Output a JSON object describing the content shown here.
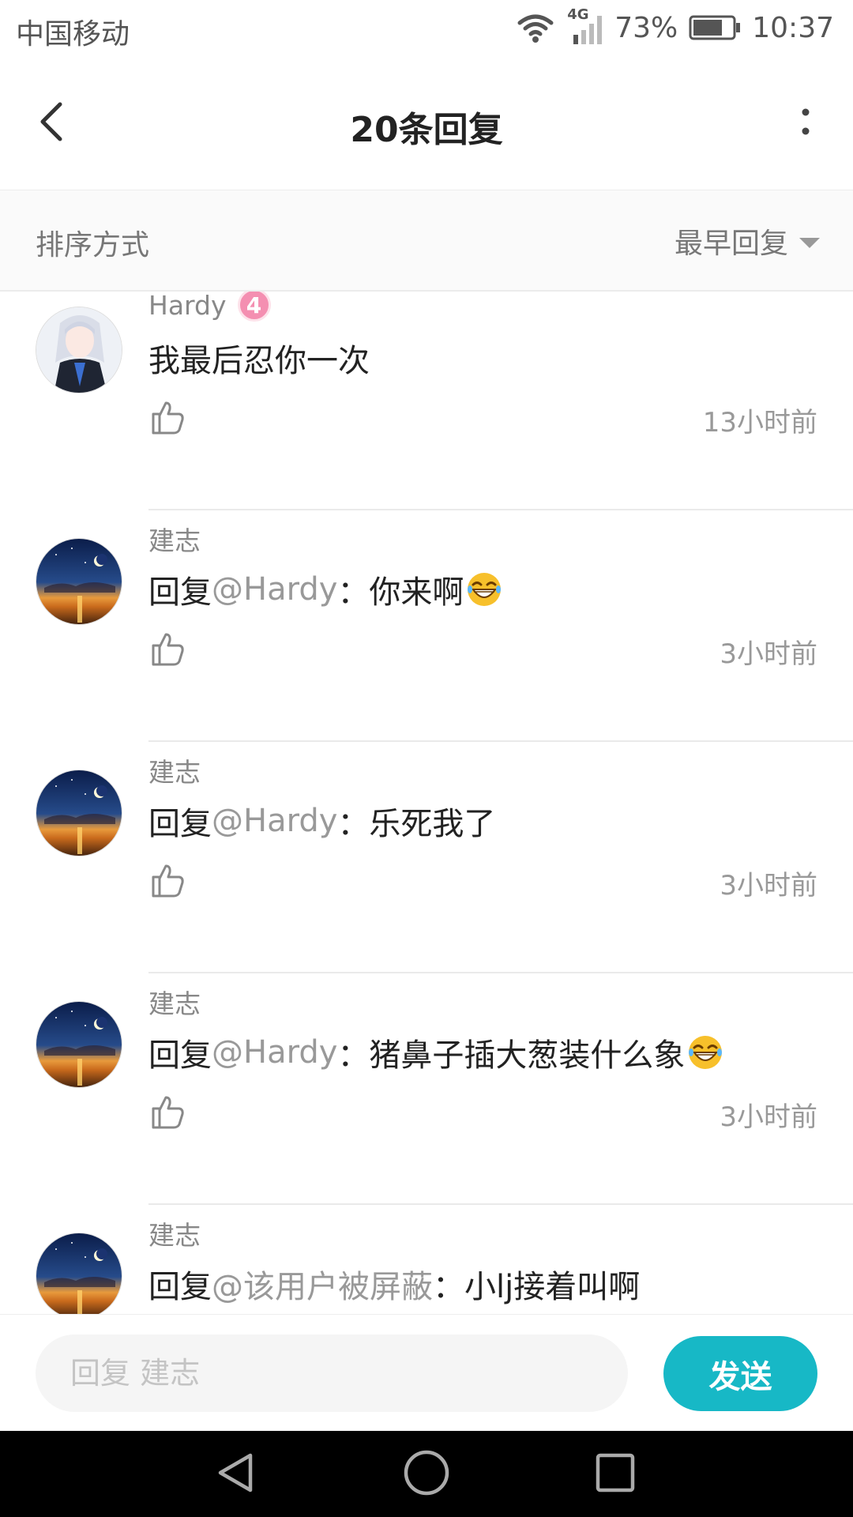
{
  "status_bar": {
    "carrier": "中国移动",
    "network": "4G",
    "battery": "73%",
    "time": "10:37"
  },
  "header": {
    "title": "20条回复",
    "back_icon": "chevron-left-icon",
    "more_icon": "more-vertical-icon"
  },
  "sort": {
    "label": "排序方式",
    "selected": "最早回复"
  },
  "comments": [
    {
      "author": "Hardy",
      "level": "4",
      "prefix": "",
      "mention": "",
      "sep": "",
      "text": "我最后忍你一次",
      "emoji": false,
      "time": "13小时前"
    },
    {
      "author": "建志",
      "level": "",
      "prefix": "回复",
      "mention": "@Hardy",
      "sep": "：",
      "text": "你来啊",
      "emoji": true,
      "time": "3小时前"
    },
    {
      "author": "建志",
      "level": "",
      "prefix": "回复",
      "mention": "@Hardy",
      "sep": "：",
      "text": "乐死我了",
      "emoji": false,
      "time": "3小时前"
    },
    {
      "author": "建志",
      "level": "",
      "prefix": "回复",
      "mention": "@Hardy",
      "sep": "：",
      "text": "猪鼻子插大葱装什么象",
      "emoji": true,
      "time": "3小时前"
    },
    {
      "author": "建志",
      "level": "",
      "prefix": "回复",
      "mention": "@该用户被屏蔽",
      "sep": "：",
      "text": "小lj接着叫啊",
      "emoji": false,
      "time": ""
    }
  ],
  "reply_bar": {
    "placeholder": "回复 建志",
    "send_label": "发送"
  },
  "colors": {
    "accent": "#17b8c6",
    "level_badge": "#f48fb1"
  }
}
